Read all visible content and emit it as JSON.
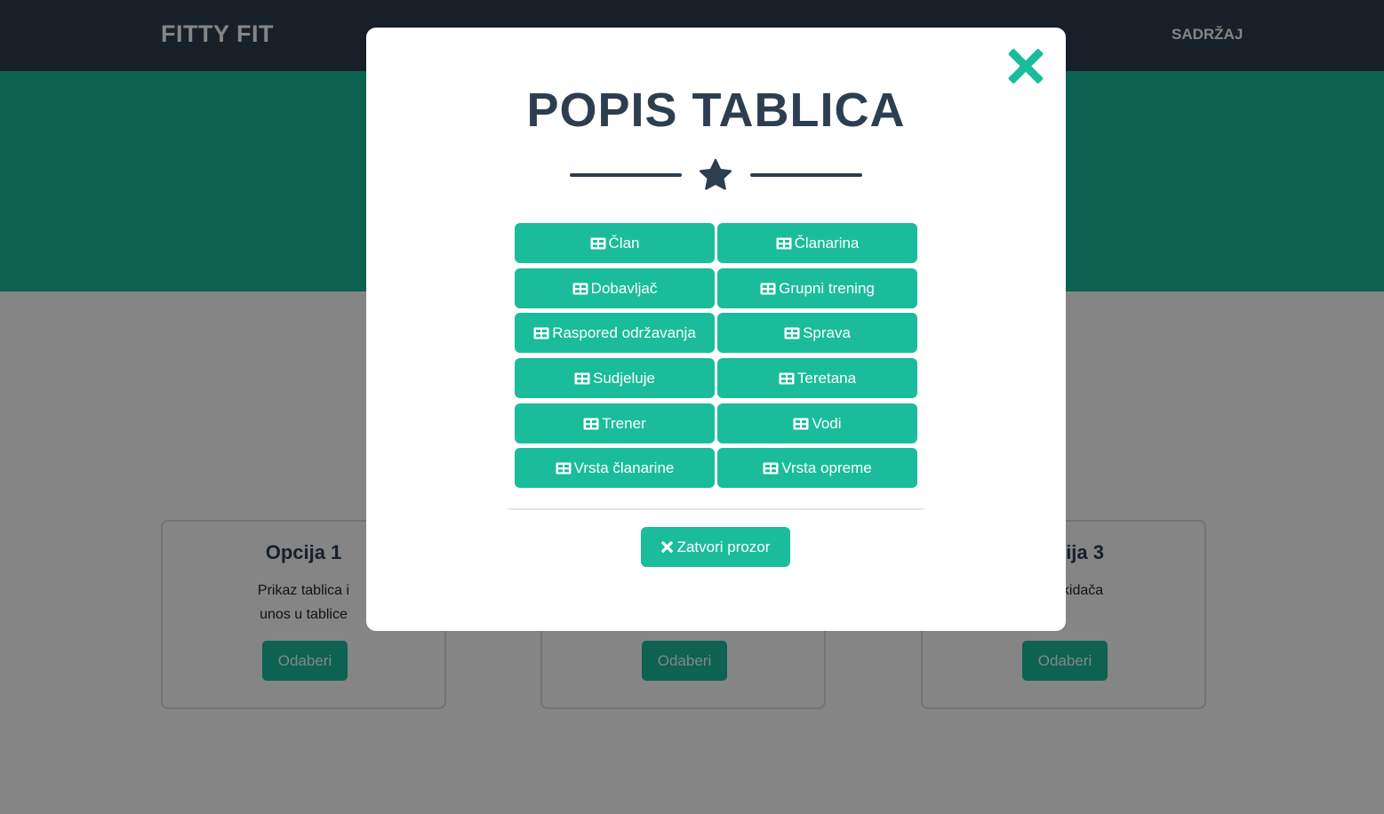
{
  "navbar": {
    "brand": "FITTY FIT",
    "links": [
      "SADRŽAJ"
    ]
  },
  "cards": [
    {
      "title": "Opcija 1",
      "text": "Prikaz tablica i unos u tablice",
      "button": "Odaberi"
    },
    {
      "title": "",
      "text": "",
      "button": "Odaberi"
    },
    {
      "title": "ija 3",
      "text": "okidača",
      "button": "Odaberi"
    }
  ],
  "modal": {
    "title": "POPIS TABLICA",
    "divider_icon": "star-icon",
    "close_icon": "close-icon",
    "table_icon": "table-icon",
    "tables": [
      "Član",
      "Članarina",
      "Dobavljač",
      "Grupni trening",
      "Raspored održavanja",
      "Sprava",
      "Sudjeluje",
      "Teretana",
      "Trener",
      "Vodi",
      "Vrsta članarine",
      "Vrsta opreme"
    ],
    "close_button": "Zatvori prozor"
  },
  "colors": {
    "primary": "#1abc9c",
    "secondary": "#2c3e50",
    "overlay": "rgba(0,0,0,0.48)"
  }
}
